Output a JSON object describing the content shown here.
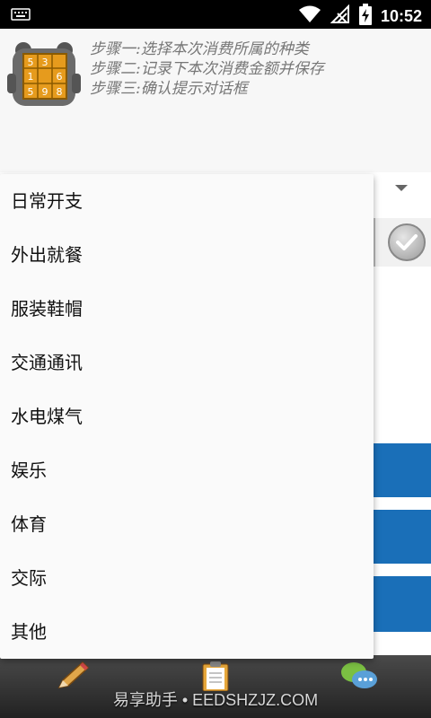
{
  "status_bar": {
    "time": "10:52",
    "icons": [
      "keyboard-icon",
      "wifi-icon",
      "no-signal-icon",
      "battery-charging-icon"
    ]
  },
  "header": {
    "steps": [
      "步骤一:选择本次消费所属的种类",
      "步骤二:记录下本次消费金额并保存",
      "步骤三:确认提示对话框"
    ],
    "logo_icon": "sudoku-robot-logo",
    "logo_digits": [
      "5",
      "3",
      "1",
      "6",
      "5",
      "9",
      "8"
    ]
  },
  "dropdown": {
    "items": [
      {
        "label": "日常开支"
      },
      {
        "label": "外出就餐"
      },
      {
        "label": "服装鞋帽"
      },
      {
        "label": "交通通讯"
      },
      {
        "label": "水电煤气"
      },
      {
        "label": "娱乐"
      },
      {
        "label": "体育"
      },
      {
        "label": "交际"
      },
      {
        "label": "其他"
      }
    ]
  },
  "bottom_nav": {
    "icons": [
      "pencil-icon",
      "clipboard-icon",
      "chat-icon"
    ],
    "watermark": "易享助手 • EEDSHZJZ.COM"
  },
  "colors": {
    "accent_blue": "#1a6fb8",
    "status_bar": "#000000",
    "bottom_bar": "#333333"
  }
}
